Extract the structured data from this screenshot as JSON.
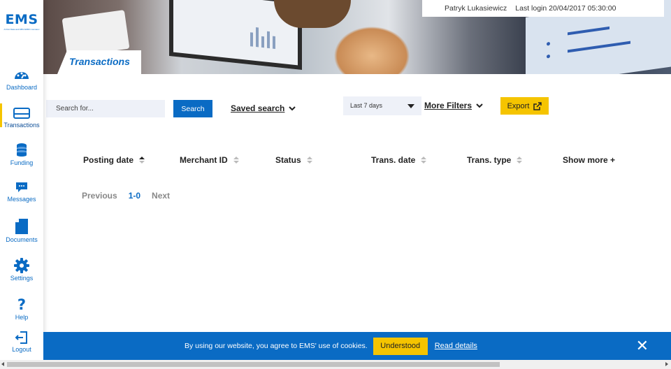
{
  "brand": {
    "logo_text": "EMS",
    "logo_tagline": "A First Data and ABN AMRO company"
  },
  "colors": {
    "brand_blue": "#0a6bc4",
    "accent_yellow": "#f5c400"
  },
  "sidebar": {
    "items": [
      {
        "label": "Dashboard",
        "icon": "dashboard-gauge-icon",
        "active": false
      },
      {
        "label": "Transactions",
        "icon": "card-icon",
        "active": true
      },
      {
        "label": "Funding",
        "icon": "coins-stack-icon",
        "active": false
      },
      {
        "label": "Messages",
        "icon": "chat-bubble-icon",
        "active": false
      },
      {
        "label": "Documents",
        "icon": "document-icon",
        "active": false
      },
      {
        "label": "Settings",
        "icon": "gear-icon",
        "active": false
      },
      {
        "label": "Help",
        "icon": "question-mark-icon",
        "active": false
      },
      {
        "label": "Logout",
        "icon": "logout-icon",
        "active": false
      }
    ]
  },
  "header": {
    "user_name": "Patryk Lukasiewicz",
    "last_login": "Last login 20/04/2017 05:30:00",
    "page_title": "Transactions"
  },
  "toolbar": {
    "search_placeholder": "Search for...",
    "search_label": "Search",
    "saved_search_label": "Saved search",
    "date_range_value": "Last 7 days",
    "more_filters_label": "More Filters",
    "export_label": "Export"
  },
  "table": {
    "columns": [
      {
        "label": "Posting date",
        "sorted": "asc"
      },
      {
        "label": "Merchant ID",
        "sorted": "none"
      },
      {
        "label": "Status",
        "sorted": "none"
      },
      {
        "label": "Trans. date",
        "sorted": "none"
      },
      {
        "label": "Trans. type",
        "sorted": "none"
      }
    ],
    "show_more_label": "Show more +",
    "rows": []
  },
  "pagination": {
    "previous": "Previous",
    "current": "1-0",
    "next": "Next"
  },
  "cookie_banner": {
    "text": "By using our website, you agree to EMS' use of cookies.",
    "accept_label": "Understood",
    "details_label": "Read details",
    "close_glyph": "✕"
  }
}
